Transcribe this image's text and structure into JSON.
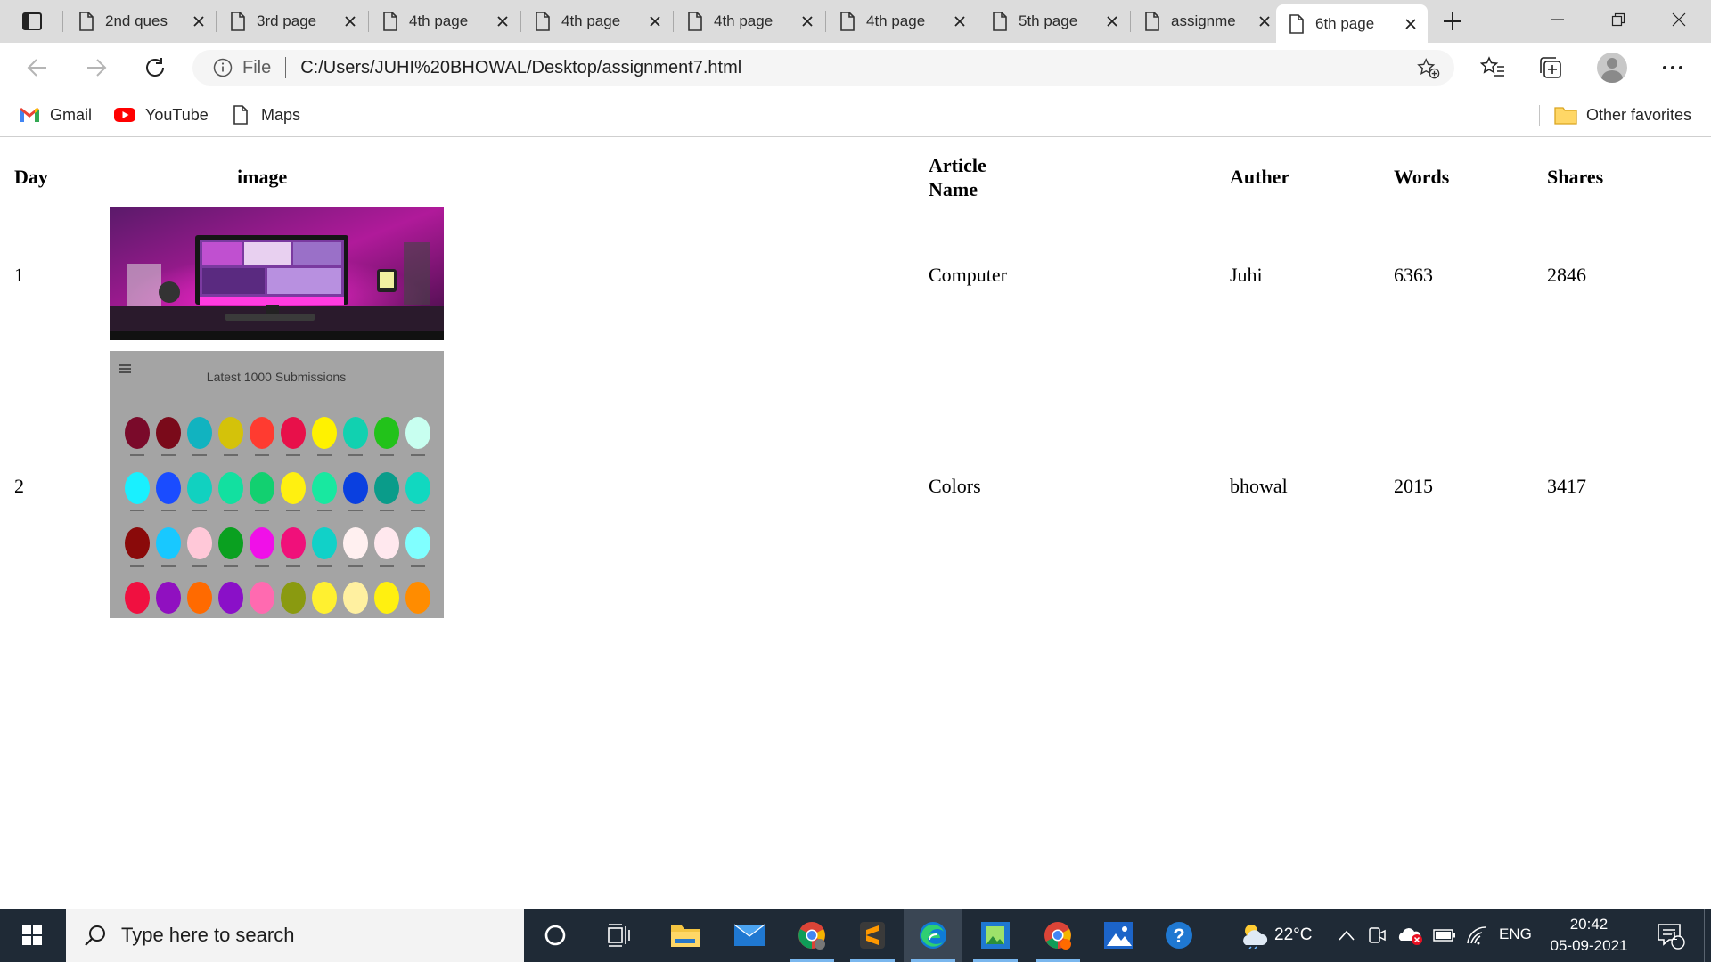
{
  "browser": {
    "tabs": [
      {
        "title": "2nd ques",
        "active": false
      },
      {
        "title": "3rd page",
        "active": false
      },
      {
        "title": "4th page",
        "active": false
      },
      {
        "title": "4th page",
        "active": false
      },
      {
        "title": "4th page",
        "active": false
      },
      {
        "title": "4th page",
        "active": false
      },
      {
        "title": "5th page",
        "active": false
      },
      {
        "title": "assignme",
        "active": false
      },
      {
        "title": "6th page",
        "active": true
      }
    ],
    "address": {
      "scheme_label": "File",
      "url": "C:/Users/JUHI%20BHOWAL/Desktop/assignment7.html"
    },
    "bookmarks": [
      {
        "label": "Gmail",
        "icon": "gmail-icon"
      },
      {
        "label": "YouTube",
        "icon": "youtube-icon"
      },
      {
        "label": "Maps",
        "icon": "page-icon"
      }
    ],
    "other_favorites": "Other favorites"
  },
  "table": {
    "headers": {
      "day": "Day",
      "image": "image",
      "article_line1": "Article",
      "article_line2": "Name",
      "author": "Auther",
      "words": "Words",
      "shares": "Shares"
    },
    "rows": [
      {
        "day": "1",
        "article": "Computer",
        "author": "Juhi",
        "words": "6363",
        "shares": "2846",
        "image": "desk-computer-photo"
      },
      {
        "day": "2",
        "article": "Colors",
        "author": "bhowal",
        "words": "2015",
        "shares": "3417",
        "image": "color-palette-photo"
      }
    ],
    "palette_image_title": "Latest 1000 Submissions"
  },
  "taskbar": {
    "search_placeholder": "Type here to search",
    "weather_temp": "22°C",
    "language": "ENG",
    "time": "20:42",
    "date": "05-09-2021",
    "notification_count": "1"
  },
  "colors": {
    "tabstrip_bg": "#dcdcdc",
    "taskbar_bg": "#1f2a36",
    "edge_blue": "#0f7bd6"
  }
}
